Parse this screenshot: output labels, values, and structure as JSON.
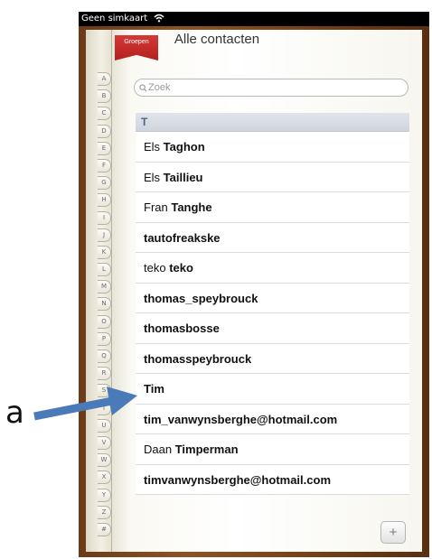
{
  "statusbar": {
    "carrier": "Geen simkaart",
    "wifi_icon": "wifi-icon"
  },
  "header": {
    "groups_tab": "Groepen",
    "title": "Alle contacten"
  },
  "search": {
    "placeholder": "Zoek"
  },
  "alphabet": [
    "A",
    "B",
    "C",
    "D",
    "E",
    "F",
    "G",
    "H",
    "I",
    "J",
    "K",
    "L",
    "M",
    "N",
    "O",
    "P",
    "Q",
    "R",
    "S",
    "T",
    "U",
    "V",
    "W",
    "X",
    "Y",
    "Z",
    "#"
  ],
  "list": {
    "section": "T",
    "contacts": [
      {
        "first": "Els",
        "last": "Taghon"
      },
      {
        "first": "Els",
        "last": "Taillieu"
      },
      {
        "first": "Fran",
        "last": "Tanghe"
      },
      {
        "first": "",
        "last": "tautofreakske"
      },
      {
        "first": "teko",
        "last": "teko"
      },
      {
        "first": "",
        "last": "thomas_speybrouck"
      },
      {
        "first": "",
        "last": "thomasbosse"
      },
      {
        "first": "",
        "last": "thomasspeybrouck"
      },
      {
        "first": "",
        "last": "Tim"
      },
      {
        "first": "",
        "last": "tim_vanwynsberghe@hotmail.com"
      },
      {
        "first": "Daan",
        "last": "Timperman"
      },
      {
        "first": "",
        "last": "timvanwynsberghe@hotmail.com"
      }
    ]
  },
  "add_button": {
    "label": "+"
  },
  "annotation": {
    "letter": "a",
    "color": "#4a7ab8"
  }
}
